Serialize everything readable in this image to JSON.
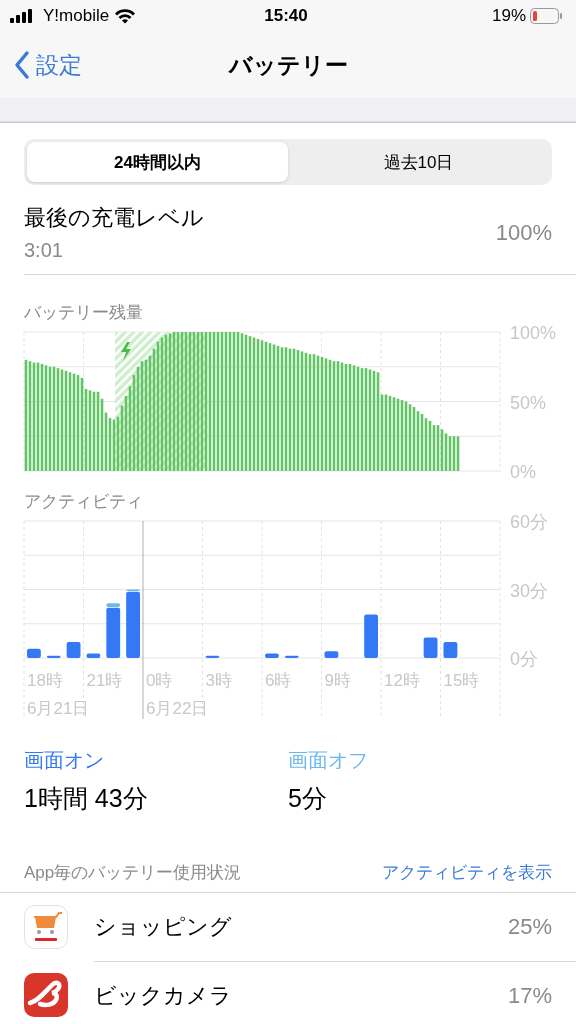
{
  "status_bar": {
    "carrier": "Y!mobile",
    "time": "15:40",
    "battery": "19%"
  },
  "nav": {
    "back": "設定",
    "title": "バッテリー"
  },
  "tabs": [
    {
      "label": "24時間以内",
      "selected": true
    },
    {
      "label": "過去10日",
      "selected": false
    }
  ],
  "last_charge": {
    "label": "最後の充電レベル",
    "time": "3:01",
    "value": "100%"
  },
  "battery_chart": {
    "title": "バッテリー残量",
    "chart_data": {
      "type": "bar",
      "ylim": [
        0,
        100
      ],
      "yticks": [
        {
          "value": 0,
          "label": "0%"
        },
        {
          "value": 50,
          "label": "50%"
        },
        {
          "value": 100,
          "label": "100%"
        }
      ],
      "values": [
        80,
        79,
        78,
        78,
        77,
        76,
        75,
        75,
        74,
        73,
        72,
        71,
        70,
        69,
        67,
        59,
        58,
        57,
        57,
        52,
        42,
        38,
        37,
        39,
        47,
        54,
        61,
        69,
        75,
        79,
        80,
        83,
        88,
        93,
        96,
        98,
        99,
        100,
        100,
        100,
        100,
        100,
        100,
        100,
        100,
        100,
        100,
        100,
        100,
        100,
        100,
        100,
        100,
        100,
        99,
        98,
        97,
        96,
        95,
        94,
        93,
        92,
        91,
        90,
        89,
        89,
        88,
        88,
        87,
        86,
        85,
        84,
        84,
        83,
        82,
        81,
        80,
        79,
        79,
        78,
        77,
        77,
        76,
        75,
        74,
        74,
        73,
        72,
        71,
        55,
        55,
        54,
        53,
        52,
        51,
        50,
        48,
        46,
        43,
        41,
        38,
        36,
        33,
        33,
        30,
        27,
        25,
        25,
        25,
        null,
        null,
        null,
        null,
        null,
        null,
        null,
        null,
        null,
        null
      ],
      "grid": true
    }
  },
  "activity_chart": {
    "title": "アクティビティ",
    "chart_data": {
      "type": "bar",
      "stacked": true,
      "grid": true,
      "ylim": [
        0,
        60
      ],
      "yticks": [
        {
          "value": 0,
          "label": "0分"
        },
        {
          "value": 30,
          "label": "30分"
        },
        {
          "value": 60,
          "label": "60分"
        }
      ],
      "categories": [
        "18時",
        null,
        null,
        "21時",
        null,
        null,
        "0時",
        null,
        null,
        "3時",
        null,
        null,
        "6時",
        null,
        null,
        "9時",
        null,
        null,
        "12時",
        null,
        null,
        "15時",
        null,
        null
      ],
      "series": [
        {
          "name": "画面オン",
          "color": "#3478f6",
          "values": [
            4,
            1,
            7,
            2,
            22,
            29,
            0,
            0,
            0,
            1,
            0,
            0,
            2,
            1,
            0,
            3,
            0,
            19,
            0,
            0,
            9,
            7,
            null,
            null
          ]
        },
        {
          "name": "画面オフ",
          "color": "#6ab8ee",
          "values": [
            0,
            0,
            0,
            0,
            2,
            1,
            0,
            0,
            0,
            0,
            0,
            0,
            0,
            0,
            0,
            0,
            0,
            0,
            0,
            0,
            0,
            0,
            null,
            null
          ]
        }
      ],
      "annotations": [
        "6月21日",
        "6月22日"
      ]
    }
  },
  "summary": [
    {
      "value": "1時間 43分"
    },
    {
      "value": "5分"
    }
  ],
  "usage": {
    "title": "App毎のバッテリー使用状況",
    "link": "アクティビティを表示",
    "apps": [
      {
        "name": "ショッピング",
        "percent": "25%",
        "kind": "cart"
      },
      {
        "name": "ビックカメラ",
        "percent": "17%",
        "kind": "red"
      }
    ]
  }
}
